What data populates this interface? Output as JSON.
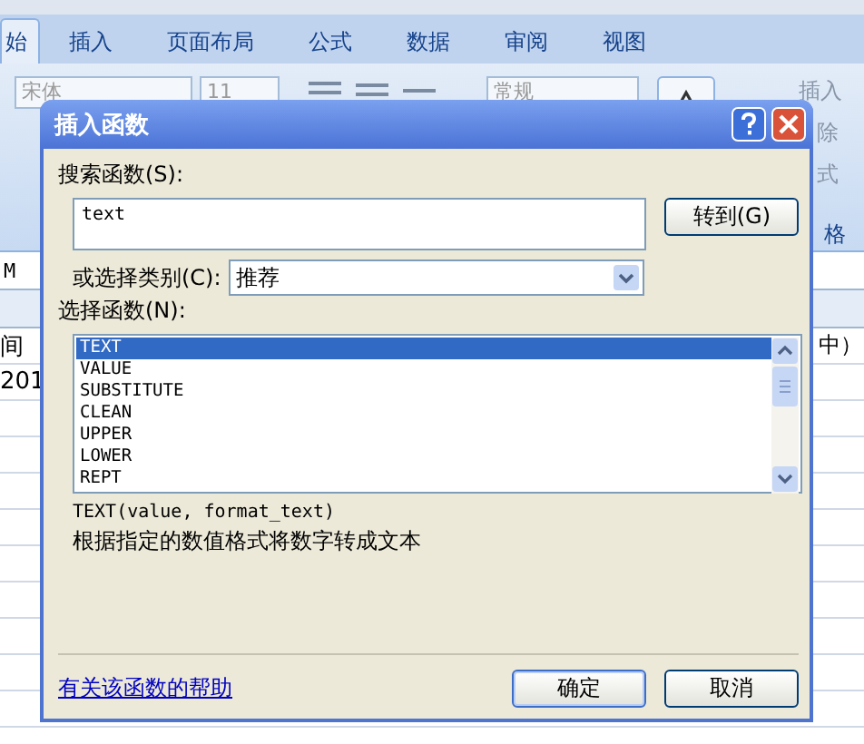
{
  "ribbon": {
    "tabs": [
      {
        "label": "始",
        "selected": true
      },
      {
        "label": "插入",
        "selected": false
      },
      {
        "label": "页面布局",
        "selected": false
      },
      {
        "label": "公式",
        "selected": false
      },
      {
        "label": "数据",
        "selected": false
      },
      {
        "label": "审阅",
        "selected": false
      },
      {
        "label": "视图",
        "selected": false
      }
    ],
    "font_name": "宋体",
    "font_size": "11",
    "number_format": "常规",
    "cells_group": [
      "插入",
      "除",
      "式"
    ],
    "group_label": "格"
  },
  "sheet": {
    "name_box": "M",
    "rows": [
      {
        "column_1": "间",
        "column_2": "中）"
      },
      {
        "column_1": "201"
      }
    ]
  },
  "dialog": {
    "title": "插入函数",
    "search_label": "搜索函数(S):",
    "search_value": "text",
    "go_button": "转到(G)",
    "category_label": "或选择类别(C):",
    "category_value": "推荐",
    "functions_label": "选择函数(N):",
    "functions": [
      {
        "label": "TEXT",
        "selected": true
      },
      {
        "label": "VALUE",
        "selected": false
      },
      {
        "label": "SUBSTITUTE",
        "selected": false
      },
      {
        "label": "CLEAN",
        "selected": false
      },
      {
        "label": "UPPER",
        "selected": false
      },
      {
        "label": "LOWER",
        "selected": false
      },
      {
        "label": "REPT",
        "selected": false
      }
    ],
    "signature": "TEXT(value, format_text)",
    "description": "根据指定的数值格式将数字转成文本",
    "help_link": "有关该函数的帮助",
    "ok_button": "确定",
    "cancel_button": "取消"
  }
}
